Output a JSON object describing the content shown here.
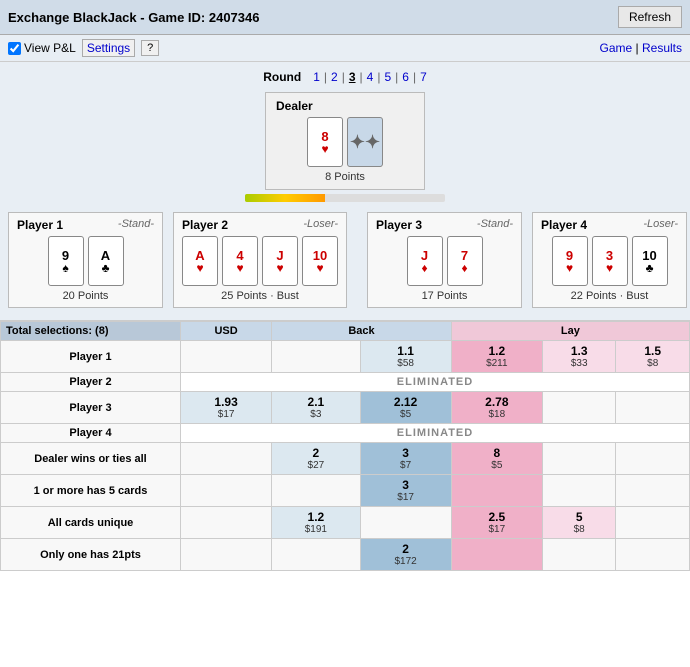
{
  "header": {
    "title": "Exchange BlackJack - Game ID: 2407346",
    "refresh_label": "Refresh"
  },
  "subheader": {
    "view_pnl_label": "View P&L",
    "settings_label": "Settings",
    "help_label": "?",
    "nav": {
      "game": "Game",
      "sep": "|",
      "results": "Results"
    }
  },
  "game": {
    "round_label": "Round",
    "rounds": [
      "1",
      "2",
      "3",
      "4",
      "5",
      "6",
      "7"
    ],
    "active_round": "3",
    "dealer": {
      "label": "Dealer",
      "cards": [
        {
          "value": "8",
          "suit": "♥",
          "color": "red"
        },
        {
          "value": "?",
          "suit": "",
          "color": "back"
        }
      ],
      "points": "8 Points"
    },
    "players": [
      {
        "id": "player1",
        "name": "Player 1",
        "status": "-Stand-",
        "cards": [
          {
            "value": "9",
            "suit": "♠",
            "color": "black"
          },
          {
            "value": "A",
            "suit": "♣",
            "color": "black"
          }
        ],
        "points": "20 Points",
        "position": "left"
      },
      {
        "id": "player2",
        "name": "Player 2",
        "status": "-Loser-",
        "cards": [
          {
            "value": "A",
            "suit": "♥",
            "color": "red"
          },
          {
            "value": "4",
            "suit": "♥",
            "color": "red"
          },
          {
            "value": "J",
            "suit": "♥",
            "color": "red"
          },
          {
            "value": "10",
            "suit": "♥",
            "color": "red"
          }
        ],
        "points": "25 Points · Bust",
        "position": "middle-left"
      },
      {
        "id": "player3",
        "name": "Player 3",
        "status": "-Stand-",
        "cards": [
          {
            "value": "J",
            "suit": "♦",
            "color": "red"
          },
          {
            "value": "7",
            "suit": "♦",
            "color": "red"
          }
        ],
        "points": "17 Points",
        "position": "middle-right"
      },
      {
        "id": "player4",
        "name": "Player 4",
        "status": "-Loser-",
        "cards": [
          {
            "value": "9",
            "suit": "♥",
            "color": "red"
          },
          {
            "value": "3",
            "suit": "♥",
            "color": "red"
          },
          {
            "value": "10",
            "suit": "♣",
            "color": "black"
          }
        ],
        "points": "22 Points · Bust",
        "position": "right"
      }
    ]
  },
  "betting": {
    "total_selections": "Total selections: (8)",
    "currency": "USD",
    "headers": {
      "back": "Back",
      "lay": "Lay"
    },
    "rows": [
      {
        "type": "player",
        "name": "Player 1",
        "cells": [
          {
            "type": "empty"
          },
          {
            "type": "empty"
          },
          {
            "type": "back",
            "odd": "1.1",
            "stake": "$58"
          },
          {
            "type": "lay-selected",
            "odd": "1.2",
            "stake": "$211"
          },
          {
            "type": "lay",
            "odd": "1.3",
            "stake": "$33"
          },
          {
            "type": "lay",
            "odd": "1.5",
            "stake": "$8"
          }
        ]
      },
      {
        "type": "eliminated",
        "name": "Player 2",
        "text": "ELIMINATED"
      },
      {
        "type": "player",
        "name": "Player 3",
        "cells": [
          {
            "type": "back",
            "odd": "1.93",
            "stake": "$17"
          },
          {
            "type": "back",
            "odd": "2.1",
            "stake": "$3"
          },
          {
            "type": "back-selected",
            "odd": "2.12",
            "stake": "$5"
          },
          {
            "type": "lay-selected",
            "odd": "2.78",
            "stake": "$18"
          },
          {
            "type": "empty"
          },
          {
            "type": "empty"
          }
        ]
      },
      {
        "type": "eliminated",
        "name": "Player 4",
        "text": "ELIMINATED"
      },
      {
        "type": "special",
        "name": "Dealer wins or ties all",
        "cells": [
          {
            "type": "empty"
          },
          {
            "type": "back",
            "odd": "2",
            "stake": "$27"
          },
          {
            "type": "back-selected",
            "odd": "3",
            "stake": "$7"
          },
          {
            "type": "lay-selected",
            "odd": "8",
            "stake": "$5"
          },
          {
            "type": "empty"
          },
          {
            "type": "empty"
          }
        ]
      },
      {
        "type": "special",
        "name": "1 or more has 5 cards",
        "cells": [
          {
            "type": "empty"
          },
          {
            "type": "empty"
          },
          {
            "type": "back-selected",
            "odd": "3",
            "stake": "$17"
          },
          {
            "type": "lay-selected"
          },
          {
            "type": "empty"
          },
          {
            "type": "empty"
          }
        ]
      },
      {
        "type": "special",
        "name": "All cards unique",
        "cells": [
          {
            "type": "empty"
          },
          {
            "type": "back",
            "odd": "1.2",
            "stake": "$191"
          },
          {
            "type": "empty"
          },
          {
            "type": "lay-selected",
            "odd": "2.5",
            "stake": "$17"
          },
          {
            "type": "lay",
            "odd": "5",
            "stake": "$8"
          },
          {
            "type": "empty"
          }
        ]
      },
      {
        "type": "special",
        "name": "Only one has 21pts",
        "cells": [
          {
            "type": "empty"
          },
          {
            "type": "empty"
          },
          {
            "type": "back-selected",
            "odd": "2",
            "stake": "$172"
          },
          {
            "type": "lay-selected"
          },
          {
            "type": "empty"
          },
          {
            "type": "empty"
          }
        ]
      }
    ]
  }
}
